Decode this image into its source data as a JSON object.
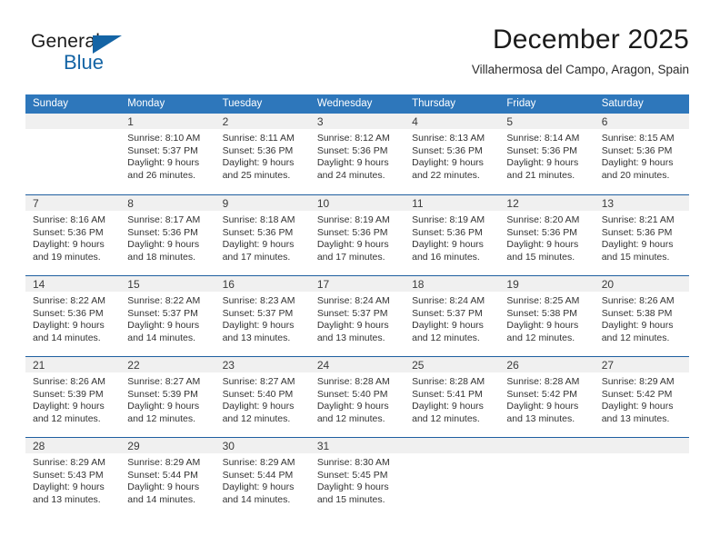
{
  "brand": {
    "name_top": "General",
    "name_bottom": "Blue",
    "accent_color": "#1464a5"
  },
  "header": {
    "title": "December 2025",
    "subtitle": "Villahermosa del Campo, Aragon, Spain"
  },
  "calendar": {
    "header_color": "#2e77bb",
    "row_divider_color": "#1f5fa0",
    "day_band_color": "#f0f0f0",
    "weekdays": [
      "Sunday",
      "Monday",
      "Tuesday",
      "Wednesday",
      "Thursday",
      "Friday",
      "Saturday"
    ],
    "weeks": [
      [
        {
          "day": "",
          "sunrise": "",
          "sunset": "",
          "daylight_line1": "",
          "daylight_line2": ""
        },
        {
          "day": "1",
          "sunrise": "Sunrise: 8:10 AM",
          "sunset": "Sunset: 5:37 PM",
          "daylight_line1": "Daylight: 9 hours",
          "daylight_line2": "and 26 minutes."
        },
        {
          "day": "2",
          "sunrise": "Sunrise: 8:11 AM",
          "sunset": "Sunset: 5:36 PM",
          "daylight_line1": "Daylight: 9 hours",
          "daylight_line2": "and 25 minutes."
        },
        {
          "day": "3",
          "sunrise": "Sunrise: 8:12 AM",
          "sunset": "Sunset: 5:36 PM",
          "daylight_line1": "Daylight: 9 hours",
          "daylight_line2": "and 24 minutes."
        },
        {
          "day": "4",
          "sunrise": "Sunrise: 8:13 AM",
          "sunset": "Sunset: 5:36 PM",
          "daylight_line1": "Daylight: 9 hours",
          "daylight_line2": "and 22 minutes."
        },
        {
          "day": "5",
          "sunrise": "Sunrise: 8:14 AM",
          "sunset": "Sunset: 5:36 PM",
          "daylight_line1": "Daylight: 9 hours",
          "daylight_line2": "and 21 minutes."
        },
        {
          "day": "6",
          "sunrise": "Sunrise: 8:15 AM",
          "sunset": "Sunset: 5:36 PM",
          "daylight_line1": "Daylight: 9 hours",
          "daylight_line2": "and 20 minutes."
        }
      ],
      [
        {
          "day": "7",
          "sunrise": "Sunrise: 8:16 AM",
          "sunset": "Sunset: 5:36 PM",
          "daylight_line1": "Daylight: 9 hours",
          "daylight_line2": "and 19 minutes."
        },
        {
          "day": "8",
          "sunrise": "Sunrise: 8:17 AM",
          "sunset": "Sunset: 5:36 PM",
          "daylight_line1": "Daylight: 9 hours",
          "daylight_line2": "and 18 minutes."
        },
        {
          "day": "9",
          "sunrise": "Sunrise: 8:18 AM",
          "sunset": "Sunset: 5:36 PM",
          "daylight_line1": "Daylight: 9 hours",
          "daylight_line2": "and 17 minutes."
        },
        {
          "day": "10",
          "sunrise": "Sunrise: 8:19 AM",
          "sunset": "Sunset: 5:36 PM",
          "daylight_line1": "Daylight: 9 hours",
          "daylight_line2": "and 17 minutes."
        },
        {
          "day": "11",
          "sunrise": "Sunrise: 8:19 AM",
          "sunset": "Sunset: 5:36 PM",
          "daylight_line1": "Daylight: 9 hours",
          "daylight_line2": "and 16 minutes."
        },
        {
          "day": "12",
          "sunrise": "Sunrise: 8:20 AM",
          "sunset": "Sunset: 5:36 PM",
          "daylight_line1": "Daylight: 9 hours",
          "daylight_line2": "and 15 minutes."
        },
        {
          "day": "13",
          "sunrise": "Sunrise: 8:21 AM",
          "sunset": "Sunset: 5:36 PM",
          "daylight_line1": "Daylight: 9 hours",
          "daylight_line2": "and 15 minutes."
        }
      ],
      [
        {
          "day": "14",
          "sunrise": "Sunrise: 8:22 AM",
          "sunset": "Sunset: 5:36 PM",
          "daylight_line1": "Daylight: 9 hours",
          "daylight_line2": "and 14 minutes."
        },
        {
          "day": "15",
          "sunrise": "Sunrise: 8:22 AM",
          "sunset": "Sunset: 5:37 PM",
          "daylight_line1": "Daylight: 9 hours",
          "daylight_line2": "and 14 minutes."
        },
        {
          "day": "16",
          "sunrise": "Sunrise: 8:23 AM",
          "sunset": "Sunset: 5:37 PM",
          "daylight_line1": "Daylight: 9 hours",
          "daylight_line2": "and 13 minutes."
        },
        {
          "day": "17",
          "sunrise": "Sunrise: 8:24 AM",
          "sunset": "Sunset: 5:37 PM",
          "daylight_line1": "Daylight: 9 hours",
          "daylight_line2": "and 13 minutes."
        },
        {
          "day": "18",
          "sunrise": "Sunrise: 8:24 AM",
          "sunset": "Sunset: 5:37 PM",
          "daylight_line1": "Daylight: 9 hours",
          "daylight_line2": "and 12 minutes."
        },
        {
          "day": "19",
          "sunrise": "Sunrise: 8:25 AM",
          "sunset": "Sunset: 5:38 PM",
          "daylight_line1": "Daylight: 9 hours",
          "daylight_line2": "and 12 minutes."
        },
        {
          "day": "20",
          "sunrise": "Sunrise: 8:26 AM",
          "sunset": "Sunset: 5:38 PM",
          "daylight_line1": "Daylight: 9 hours",
          "daylight_line2": "and 12 minutes."
        }
      ],
      [
        {
          "day": "21",
          "sunrise": "Sunrise: 8:26 AM",
          "sunset": "Sunset: 5:39 PM",
          "daylight_line1": "Daylight: 9 hours",
          "daylight_line2": "and 12 minutes."
        },
        {
          "day": "22",
          "sunrise": "Sunrise: 8:27 AM",
          "sunset": "Sunset: 5:39 PM",
          "daylight_line1": "Daylight: 9 hours",
          "daylight_line2": "and 12 minutes."
        },
        {
          "day": "23",
          "sunrise": "Sunrise: 8:27 AM",
          "sunset": "Sunset: 5:40 PM",
          "daylight_line1": "Daylight: 9 hours",
          "daylight_line2": "and 12 minutes."
        },
        {
          "day": "24",
          "sunrise": "Sunrise: 8:28 AM",
          "sunset": "Sunset: 5:40 PM",
          "daylight_line1": "Daylight: 9 hours",
          "daylight_line2": "and 12 minutes."
        },
        {
          "day": "25",
          "sunrise": "Sunrise: 8:28 AM",
          "sunset": "Sunset: 5:41 PM",
          "daylight_line1": "Daylight: 9 hours",
          "daylight_line2": "and 12 minutes."
        },
        {
          "day": "26",
          "sunrise": "Sunrise: 8:28 AM",
          "sunset": "Sunset: 5:42 PM",
          "daylight_line1": "Daylight: 9 hours",
          "daylight_line2": "and 13 minutes."
        },
        {
          "day": "27",
          "sunrise": "Sunrise: 8:29 AM",
          "sunset": "Sunset: 5:42 PM",
          "daylight_line1": "Daylight: 9 hours",
          "daylight_line2": "and 13 minutes."
        }
      ],
      [
        {
          "day": "28",
          "sunrise": "Sunrise: 8:29 AM",
          "sunset": "Sunset: 5:43 PM",
          "daylight_line1": "Daylight: 9 hours",
          "daylight_line2": "and 13 minutes."
        },
        {
          "day": "29",
          "sunrise": "Sunrise: 8:29 AM",
          "sunset": "Sunset: 5:44 PM",
          "daylight_line1": "Daylight: 9 hours",
          "daylight_line2": "and 14 minutes."
        },
        {
          "day": "30",
          "sunrise": "Sunrise: 8:29 AM",
          "sunset": "Sunset: 5:44 PM",
          "daylight_line1": "Daylight: 9 hours",
          "daylight_line2": "and 14 minutes."
        },
        {
          "day": "31",
          "sunrise": "Sunrise: 8:30 AM",
          "sunset": "Sunset: 5:45 PM",
          "daylight_line1": "Daylight: 9 hours",
          "daylight_line2": "and 15 minutes."
        },
        {
          "day": "",
          "sunrise": "",
          "sunset": "",
          "daylight_line1": "",
          "daylight_line2": ""
        },
        {
          "day": "",
          "sunrise": "",
          "sunset": "",
          "daylight_line1": "",
          "daylight_line2": ""
        },
        {
          "day": "",
          "sunrise": "",
          "sunset": "",
          "daylight_line1": "",
          "daylight_line2": ""
        }
      ]
    ]
  }
}
